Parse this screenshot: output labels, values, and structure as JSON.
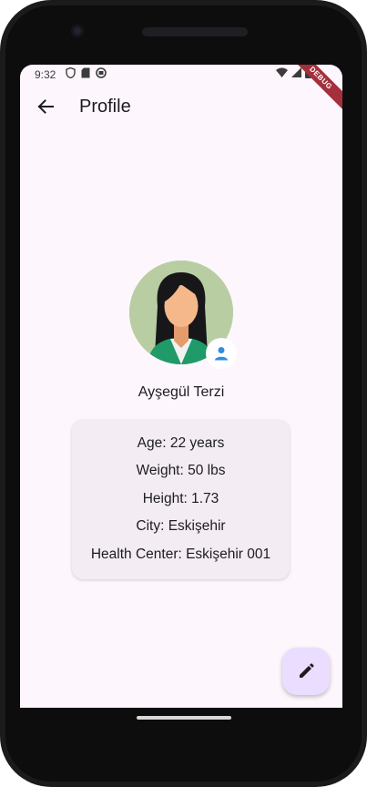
{
  "status_bar": {
    "time": "9:32",
    "left_icons": [
      "shield-icon",
      "sd-card-icon",
      "app-icon"
    ],
    "right_icons": [
      "wifi-icon",
      "signal-icon",
      "battery-icon"
    ]
  },
  "debug_banner": "DEBUG",
  "app_bar": {
    "back_icon": "arrow-back-icon",
    "title": "Profile"
  },
  "profile": {
    "name": "Ayşegül Terzi",
    "badge_icon": "person-icon",
    "details": [
      "Age: 22 years",
      "Weight: 50 lbs",
      "Height: 1.73",
      "City: Eskişehir",
      "Health Center: Eskişehir 001"
    ]
  },
  "fab": {
    "icon": "edit-icon"
  },
  "colors": {
    "background": "#fdf7fd",
    "card": "#f3edf3",
    "fab": "#eaddff",
    "avatar_bg": "#b9cda3",
    "badge_icon": "#2f8de0",
    "debug": "#a4303c"
  }
}
